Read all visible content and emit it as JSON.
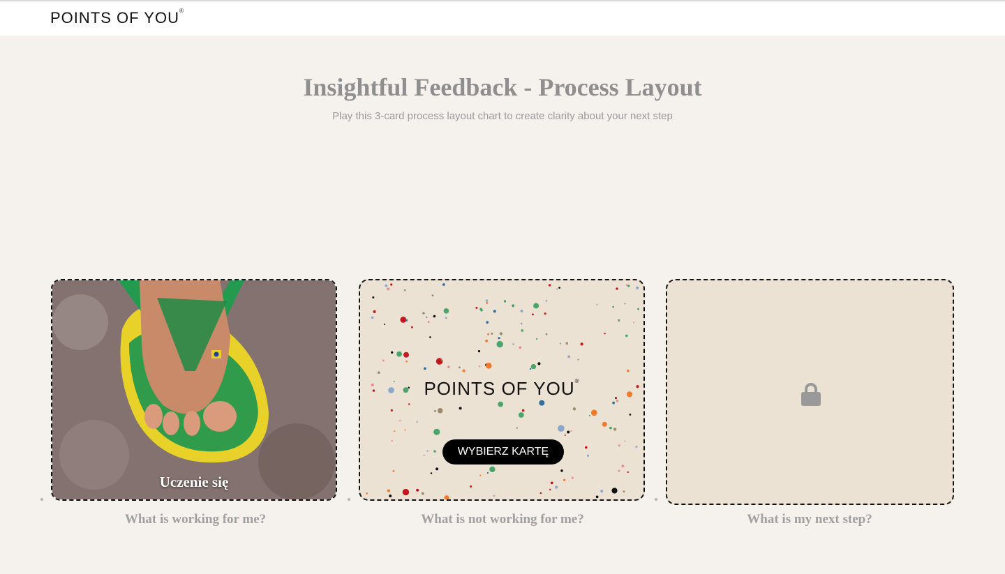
{
  "header": {
    "logo_text": "POINTS OF YOU",
    "logo_mark": "®"
  },
  "main": {
    "title": "Insightful Feedback - Process Layout",
    "subtitle": "Play this 3-card process layout chart to create clarity about your next step"
  },
  "slots": [
    {
      "label": "What is working for me?",
      "card_name": "Uczenie się"
    },
    {
      "label": "What is not working for me?",
      "deck_logo": "POINTS OF YOU",
      "button_label": "WYBIERZ KARTĘ"
    },
    {
      "label": "What is my next step?",
      "icon": "lock-icon"
    }
  ],
  "colors": {
    "background": "#f5f1ed",
    "card_back": "#ece2d4",
    "button": "#000000",
    "label": "#a0a0a0"
  }
}
